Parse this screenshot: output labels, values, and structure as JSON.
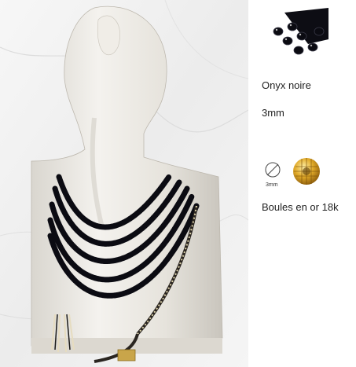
{
  "product": {
    "stone_name": "Onyx noire",
    "stone_size": "3mm",
    "diameter_caption": "3mm",
    "gold_beads_label": "Boules en or 18k"
  },
  "colors": {
    "onyx": "#0b0b12",
    "gold": "#d9a521",
    "bust": "#ece9e3",
    "marble": "#f3f3f3"
  },
  "icons": {
    "diameter": "diameter-icon",
    "gold_bead": "gold-bead-icon"
  }
}
